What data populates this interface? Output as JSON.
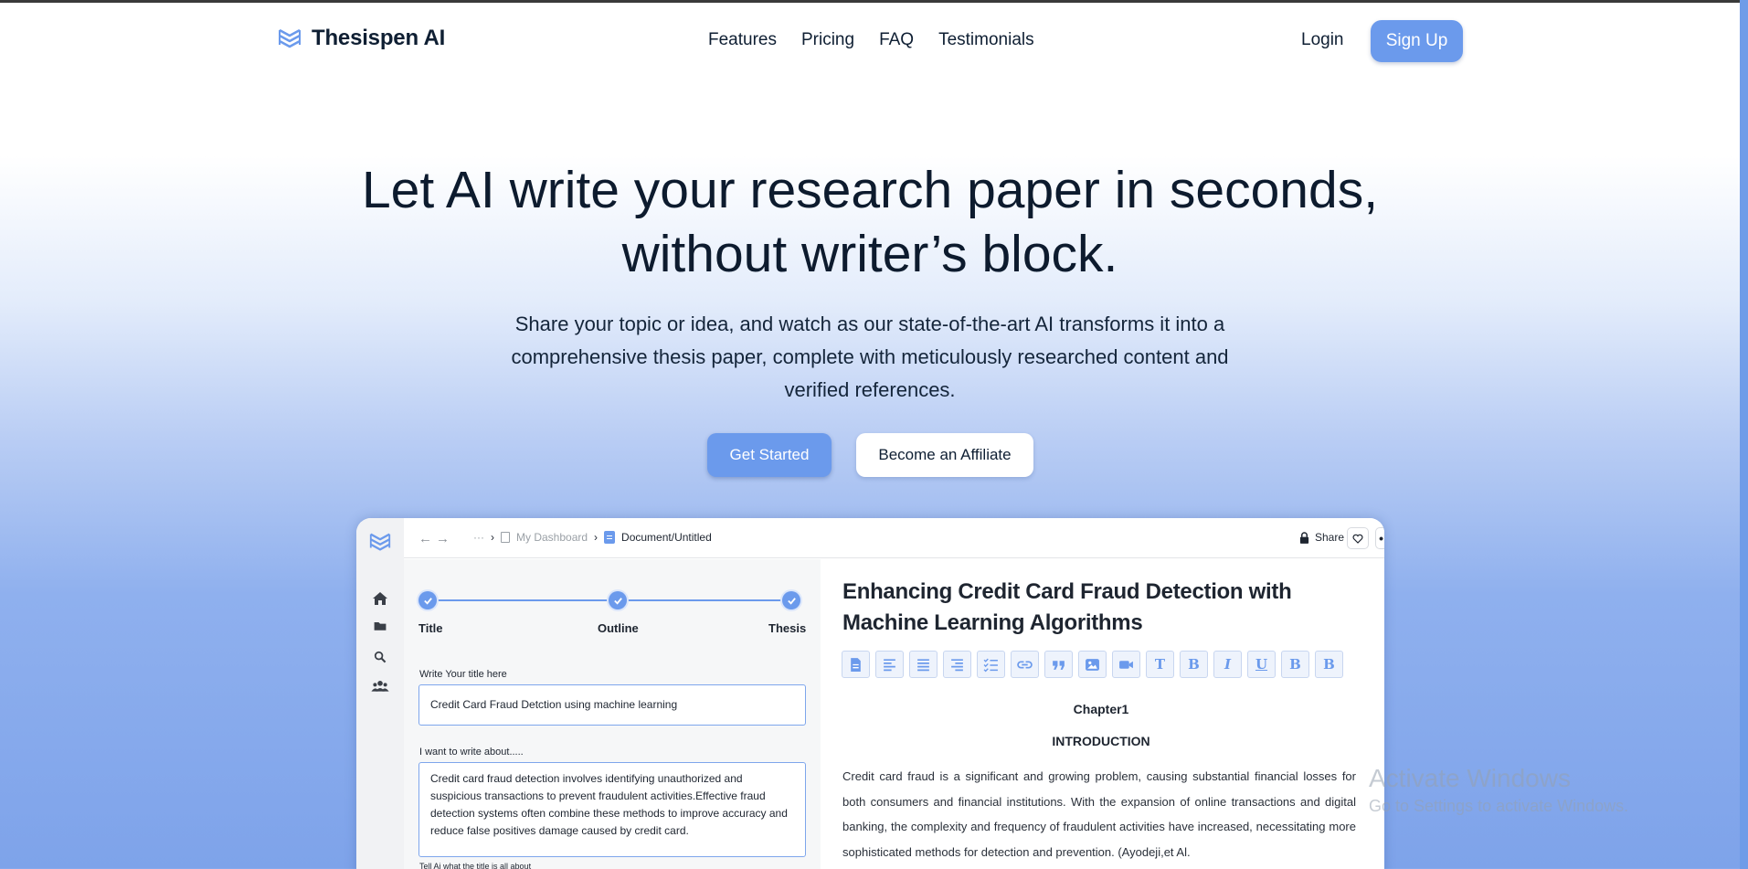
{
  "brand": {
    "name": "Thesispen AI"
  },
  "nav": {
    "links": [
      "Features",
      "Pricing",
      "FAQ",
      "Testimonials"
    ],
    "login": "Login",
    "signup": "Sign Up"
  },
  "hero": {
    "title_line1": "Let AI write your research paper in seconds,",
    "title_line2": "without writer’s block.",
    "sub_line1": "Share your topic or idea, and watch as our state-of-the-art AI transforms it into a",
    "sub_line2": "comprehensive thesis paper, complete with meticulously researched content and",
    "sub_line3": "verified references.",
    "cta_primary": "Get Started",
    "cta_secondary": "Become an Affiliate"
  },
  "app": {
    "sidebar_icons": [
      "logo-icon",
      "home-icon",
      "folder-icon",
      "search-icon",
      "users-icon"
    ],
    "breadcrumb": {
      "ellipsis": "···",
      "parent": "My Dashboard",
      "current": "Document/Untitled"
    },
    "share": "Share",
    "steps": [
      "Title",
      "Outline",
      "Thesis"
    ],
    "title_label": "Write Your title here",
    "title_value": "Credit Card Fraud Detction using machine learning",
    "about_label": "I want to write about.....",
    "about_value": "Credit card fraud detection involves identifying unauthorized and suspicious transactions to prevent fraudulent activities.Effective fraud detection systems often combine these methods to improve accuracy and reduce false positives damage caused by credit card.",
    "hint_label": "Tell Ai what the title is all about",
    "doc_title": "Enhancing Credit Card Fraud Detection with Machine Learning Algorithms",
    "toolbar": [
      "document-icon",
      "align-left-icon",
      "align-center-icon",
      "align-right-icon",
      "checklist-icon",
      "link-icon",
      "quote-icon",
      "image-icon",
      "video-icon",
      "T",
      "B",
      "I",
      "U",
      "B",
      "B"
    ],
    "chapter": "Chapter1",
    "section": "INTRODUCTION",
    "body": "Credit card fraud is a significant and growing problem, causing substantial financial losses for both consumers and financial institutions. With the expansion of online transactions and digital banking, the complexity and frequency of fraudulent activities have increased, necessitating more sophisticated methods for detection and prevention. (Ayodeji,et Al."
  },
  "watermark": {
    "line1": "Activate Windows",
    "line2": "Go to Settings to activate Windows."
  },
  "colors": {
    "accent": "#6b9aec",
    "text": "#0f1f33"
  }
}
